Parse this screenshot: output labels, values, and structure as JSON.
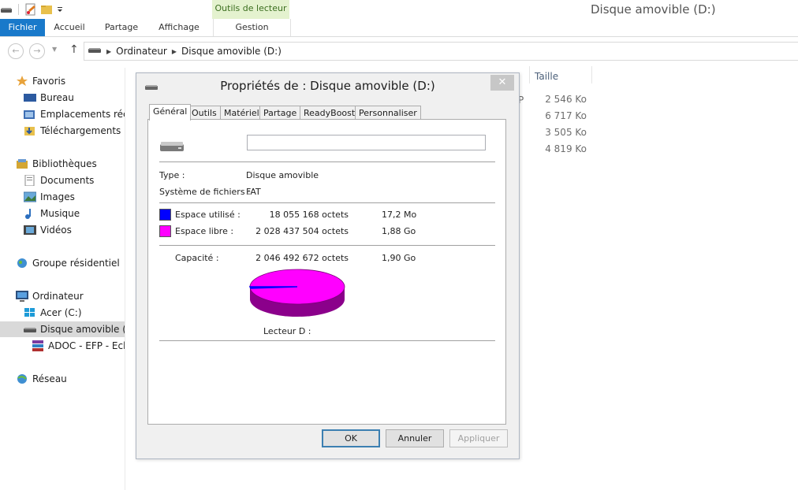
{
  "window": {
    "title": "Disque amovible (D:)"
  },
  "ribbon": {
    "contextual_header": "Outils de lecteur",
    "tabs": {
      "fichier": "Fichier",
      "accueil": "Accueil",
      "partage": "Partage",
      "affichage": "Affichage",
      "gestion": "Gestion"
    }
  },
  "address": {
    "crumb1": "Ordinateur",
    "crumb2": "Disque amovible (D:)"
  },
  "nav": {
    "favoris": "Favoris",
    "bureau": "Bureau",
    "emplacements": "Emplacements réce",
    "telechargements": "Téléchargements",
    "bibliotheques": "Bibliothèques",
    "documents": "Documents",
    "images": "Images",
    "musique": "Musique",
    "videos": "Vidéos",
    "groupe": "Groupe résidentiel",
    "ordinateur": "Ordinateur",
    "acer": "Acer (C:)",
    "disque": "Disque amovible (D:",
    "adoc": "ADOC - EFP - Eche",
    "reseau": "Réseau"
  },
  "filelist": {
    "col_taille": "Taille",
    "partial_char": "P",
    "sizes": [
      "2 546 Ko",
      "6 717 Ko",
      "3 505 Ko",
      "4 819 Ko"
    ]
  },
  "dialog": {
    "title": "Propriétés de : Disque amovible (D:)",
    "close_glyph": "✕",
    "tabs": {
      "general": "Général",
      "outils": "Outils",
      "materiel": "Matériel",
      "partage": "Partage",
      "readyboost": "ReadyBoost",
      "personnaliser": "Personnaliser"
    },
    "name_value": "",
    "type_label": "Type :",
    "type_value": "Disque amovible",
    "fs_label": "Système de fichiers :",
    "fs_value": "FAT",
    "used_label": "Espace utilisé :",
    "used_bytes": "18 055 168 octets",
    "used_human": "17,2 Mo",
    "free_label": "Espace libre :",
    "free_bytes": "2 028 437 504 octets",
    "free_human": "1,88 Go",
    "cap_label": "Capacité :",
    "cap_bytes": "2 046 492 672 octets",
    "cap_human": "1,90 Go",
    "drive_label": "Lecteur D :",
    "ok": "OK",
    "cancel": "Annuler",
    "apply": "Appliquer",
    "used_fraction": 0.0088,
    "colors": {
      "used": "#0000ff",
      "free": "#ff00ff"
    }
  }
}
